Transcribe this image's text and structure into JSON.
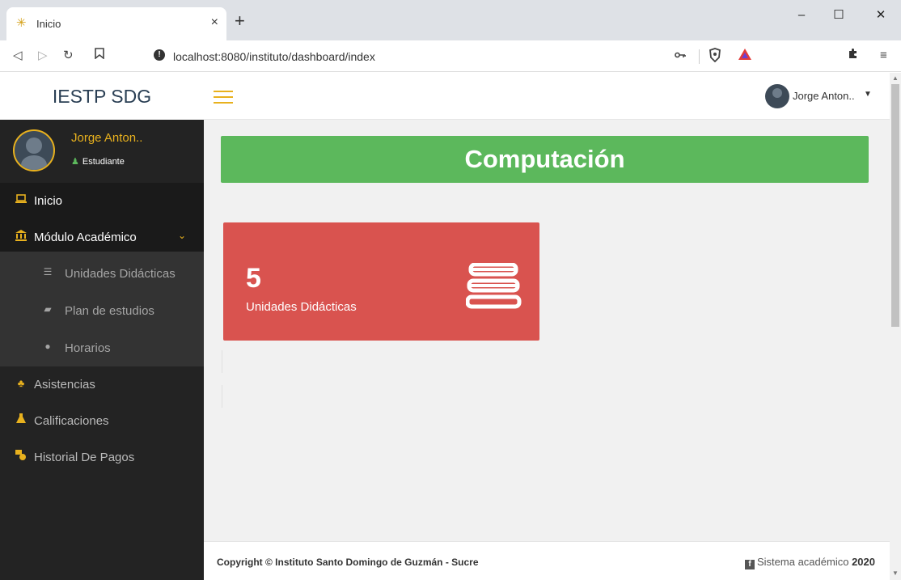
{
  "browser": {
    "tab_title": "Inicio",
    "tab_close": "×",
    "new_tab": "+",
    "url": "localhost:8080/instituto/dashboard/index",
    "controls": {
      "minimize": "–",
      "maximize": "☐",
      "close": "✕"
    }
  },
  "header": {
    "brand": "IESTP SDG",
    "user_name": "Jorge Anton..",
    "accent_color": "#e8b11e"
  },
  "sidebar": {
    "profile_name": "Jorge Anton..",
    "profile_role": "Estudiante",
    "items": [
      {
        "label": "Inicio",
        "icon": "laptop-icon"
      },
      {
        "label": "Módulo Académico",
        "icon": "institution-icon"
      },
      {
        "label": "Asistencias",
        "icon": "users-icon"
      },
      {
        "label": "Calificaciones",
        "icon": "flask-icon"
      },
      {
        "label": "Historial De Pagos",
        "icon": "money-icon"
      }
    ],
    "subitems": [
      {
        "label": "Unidades Didácticas",
        "icon": "book-icon"
      },
      {
        "label": "Plan de estudios",
        "icon": "folder-icon"
      },
      {
        "label": "Horarios",
        "icon": "clock-icon"
      }
    ]
  },
  "main": {
    "title": "Computación",
    "title_color": "#5cb85c",
    "stat": {
      "value": "5",
      "label": "Unidades Didácticas",
      "color": "#d9534f",
      "icon": "books-icon"
    }
  },
  "footer": {
    "copyright": "Copyright © Instituto Santo Domingo de Guzmán - Sucre",
    "system_text": "Sistema académico",
    "year": "2020"
  }
}
